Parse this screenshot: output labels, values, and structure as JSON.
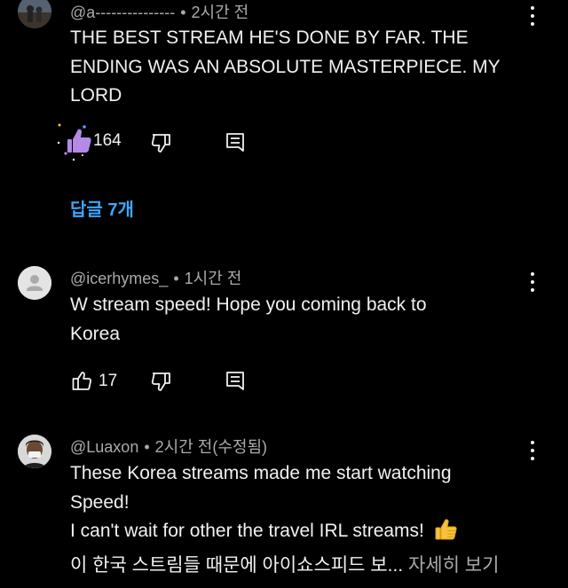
{
  "colors": {
    "background": "#000000",
    "text": "#f1f1f1",
    "meta": "#aaaaaa",
    "link": "#3ea6ff",
    "liked_thumb": "#b48ae6"
  },
  "comments": [
    {
      "author": "@a---------------",
      "separator": "•",
      "time": "2시간 전",
      "lines": [
        "THE BEST STREAM HE'S DONE BY FAR. THE",
        "ENDING WAS AN ABSOLUTE MASTERPIECE. MY",
        "LORD"
      ],
      "like_count": "164",
      "liked": true,
      "replies_label": "답글 7개",
      "icons": [
        "thumb-up-filled-icon",
        "thumb-down-icon",
        "reply-icon",
        "more-vert-icon"
      ]
    },
    {
      "author": "@icerhymes_",
      "separator": "•",
      "time": "1시간 전",
      "lines": [
        "W stream speed! Hope you coming back to",
        "Korea"
      ],
      "like_count": "17",
      "liked": false,
      "icons": [
        "thumb-up-icon",
        "thumb-down-icon",
        "reply-icon",
        "more-vert-icon"
      ]
    },
    {
      "author": "@Luaxon",
      "separator": "•",
      "time": "2시간 전(수정됨)",
      "lines": [
        "These Korea streams made me start watching",
        "Speed!",
        "I can't wait for other the travel IRL streams!"
      ],
      "emoji": "👍",
      "last_line": "이 한국 스트림들 때문에 아이쇼스피드 보...",
      "more_label": "자세히 보기",
      "icons": [
        "more-vert-icon"
      ]
    }
  ]
}
